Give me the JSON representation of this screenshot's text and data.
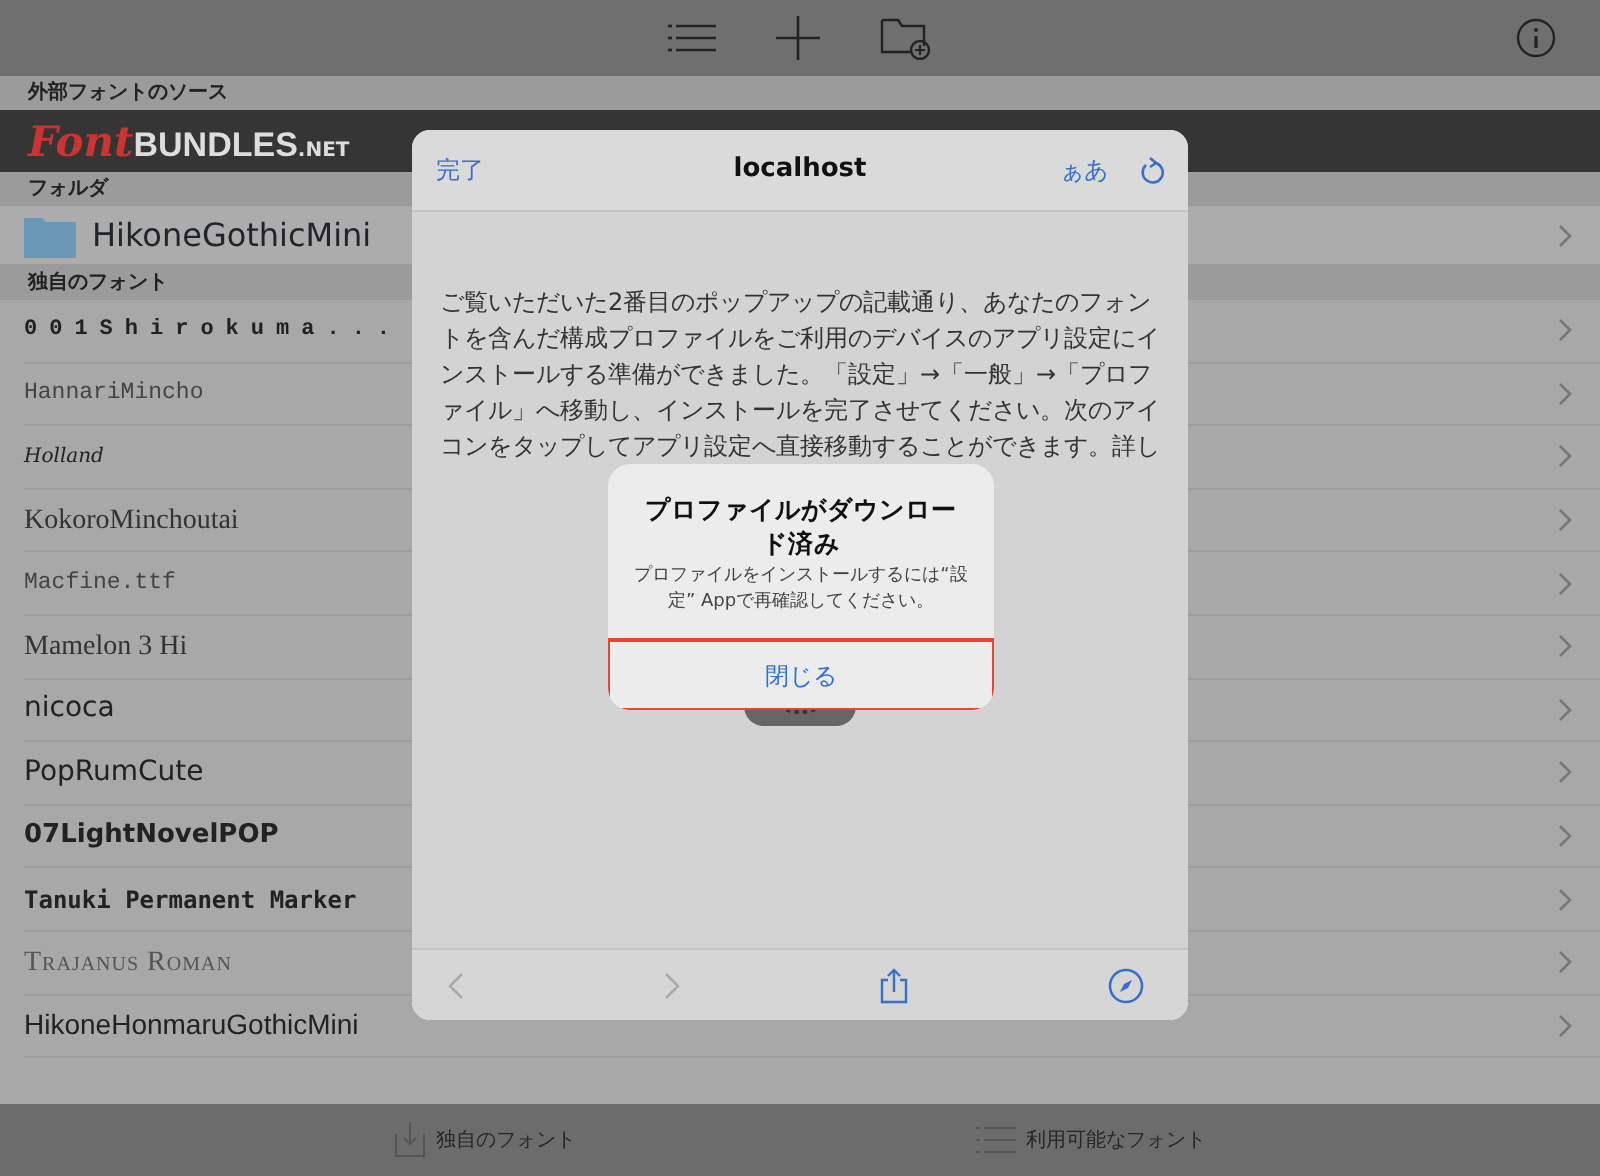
{
  "source_section": {
    "header": "外部フォントのソース",
    "logo": {
      "script_part": "Font",
      "block_part": "BUNDLES",
      "suffix": ".NET"
    }
  },
  "folder_section": {
    "header": "フォルダ",
    "folders": [
      {
        "name": "HikoneGothicMini"
      }
    ]
  },
  "fonts_section": {
    "header": "独自のフォント",
    "fonts": [
      {
        "name": "001Shirokuma...",
        "kind": "spaced"
      },
      {
        "name": "HannariMincho",
        "kind": "mono"
      },
      {
        "name": "Holland",
        "kind": "script"
      },
      {
        "name": "KokoroMinchoutai",
        "kind": "serif"
      },
      {
        "name": "Macfine.ttf",
        "kind": "mono"
      },
      {
        "name": "Mamelon 3 Hi",
        "kind": "serif"
      },
      {
        "name": "nicoca",
        "kind": "rounded"
      },
      {
        "name": "PopRumCute",
        "kind": "rounded"
      },
      {
        "name": "07LightNovelPOP",
        "kind": "bold"
      },
      {
        "name": "Tanuki Permanent Marker",
        "kind": "marker"
      },
      {
        "name": "Trajanus Roman",
        "kind": "smallcaps"
      },
      {
        "name": "HikoneHonmaruGothicMini",
        "kind": "sans"
      }
    ]
  },
  "tab_bar": [
    {
      "label": "独自のフォント"
    },
    {
      "label": "利用可能なフォント"
    }
  ],
  "sheet": {
    "done": "完了",
    "title": "localhost",
    "text_size": "ぁあ",
    "body": "ご覧いただいた2番目のポップアップの記載通り、あなたのフォントを含んだ構成プロファイルをご利用のデバイスのアプリ設定にインストールする準備ができました。「設定」→「一般」→「プロファイル」へ移動し、インストールを完了させてください。次のアイコンをタップしてアプリ設定へ直接移動することができます。詳し",
    "alert": {
      "title": "プロファイルがダウンロード済み",
      "message": "プロファイルをインストールするには“設定” Appで再確認してください。",
      "button": "閉じる",
      "highlighted": true
    }
  }
}
